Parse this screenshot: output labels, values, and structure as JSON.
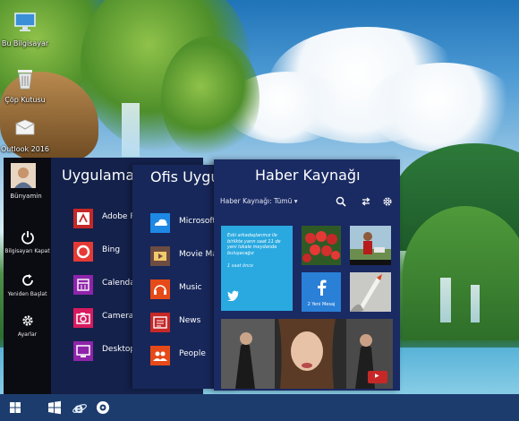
{
  "desktop": {
    "icons": [
      {
        "label": "Bu Bilgisayar",
        "icon": "computer-icon"
      },
      {
        "label": "Çöp Kutusu",
        "icon": "recycle-bin-icon"
      },
      {
        "label": "Outlook 2016",
        "icon": "outlook-icon"
      }
    ]
  },
  "start_menu": {
    "user": {
      "name": "Bünyamin",
      "icon": "user-avatar"
    },
    "power_buttons": [
      {
        "label": "Bilgisayarı Kapat",
        "icon": "power-icon"
      },
      {
        "label": "Yeniden Başlat",
        "icon": "restart-icon"
      },
      {
        "label": "Ayarlar",
        "icon": "gear-icon"
      }
    ],
    "apps_panel": {
      "title": "Uygulamalar",
      "items": [
        {
          "label": "Adobe Reader",
          "icon": "adobe-reader-icon",
          "color": "#c62828"
        },
        {
          "label": "Bing",
          "icon": "bing-icon",
          "color": "#e53935"
        },
        {
          "label": "Calendar",
          "icon": "calendar-icon",
          "color": "#8e24aa"
        },
        {
          "label": "Camera",
          "icon": "camera-icon",
          "color": "#d81b60"
        },
        {
          "label": "Desktop",
          "icon": "desktop-icon",
          "color": "#8e24aa"
        }
      ]
    },
    "office_panel": {
      "title": "Ofis Uygulamaları",
      "items": [
        {
          "label": "Microsoft Store",
          "icon": "onedrive-icon",
          "color": "#1e88e5"
        },
        {
          "label": "Movie Maker",
          "icon": "movie-maker-icon",
          "color": "#6d4c41"
        },
        {
          "label": "Music",
          "icon": "music-icon",
          "color": "#e64a19"
        },
        {
          "label": "News",
          "icon": "news-icon",
          "color": "#c62828"
        },
        {
          "label": "People",
          "icon": "people-icon",
          "color": "#e64a19"
        }
      ]
    },
    "news_panel": {
      "title": "Haber Kaynağı",
      "filter_label": "Haber Kaynağı: Tümü",
      "twitter_tile": {
        "text": "Eski arkadaşlarımız ile birlikte yarın saat 11 de yeni lokale meydanda buluşacağız",
        "time": "1 saat önce"
      },
      "facebook_tile": {
        "label": "2 Yeni Mesaj"
      }
    }
  },
  "colors": {
    "start_left": "#0b0b12",
    "apps_panel": "#14214b",
    "office_panel": "#17275a",
    "news_panel": "#1a2a63",
    "twitter": "#2aa9e0",
    "facebook": "#2a7fd6",
    "taskbar": "#1d3c6e"
  }
}
